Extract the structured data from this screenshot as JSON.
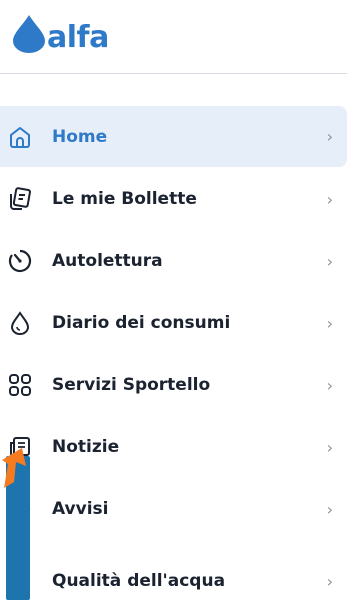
{
  "app": {
    "logo_text": "alfa",
    "brand_color": "#2f79c9"
  },
  "menu": {
    "items": [
      {
        "label": "Home",
        "icon": "home-icon",
        "chevron": "›",
        "active": true
      },
      {
        "label": "Le mie Bollette",
        "icon": "bills-icon",
        "chevron": "›"
      },
      {
        "label": "Autolettura",
        "icon": "meter-reading-icon",
        "chevron": "›"
      },
      {
        "label": "Diario dei consumi",
        "icon": "water-drop-icon",
        "chevron": "›"
      },
      {
        "label": "Servizi Sportello",
        "icon": "grid-icon",
        "chevron": "›"
      },
      {
        "label": "Notizie",
        "icon": "news-icon",
        "chevron": "›"
      },
      {
        "label": "Avvisi",
        "icon": "alert-icon",
        "chevron": "›"
      },
      {
        "label": "Qualità dell'acqua",
        "icon": "water-quality-icon",
        "chevron": "›"
      }
    ]
  },
  "colors": {
    "active_bg": "#e6eef9",
    "text": "#1b2230",
    "chevron": "#8c939e",
    "annotation_orange": "#f47b20",
    "annotation_blue": "#1e74ad"
  }
}
